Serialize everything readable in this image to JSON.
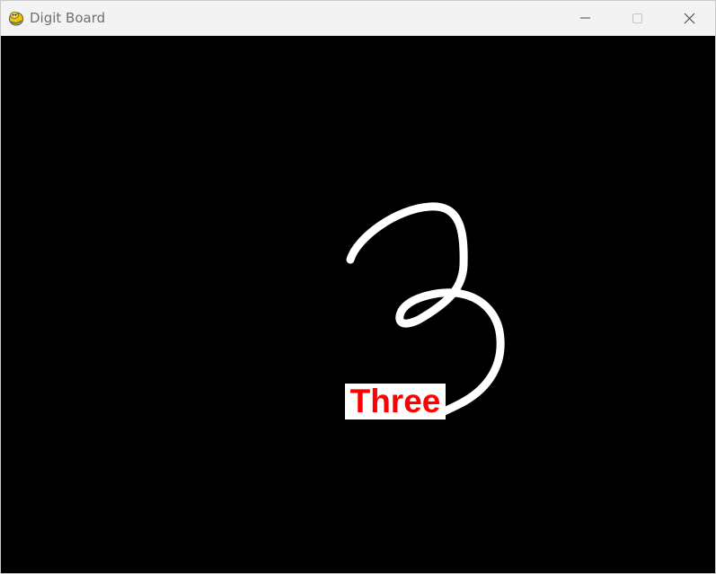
{
  "window": {
    "title": "Digit Board",
    "app_icon": "pygame-snake-icon",
    "controls": [
      "minimize-icon",
      "maximize-icon",
      "close-icon"
    ]
  },
  "canvas": {
    "background": "#000000",
    "stroke_color": "#ffffff",
    "drawn_digit": "3"
  },
  "prediction": {
    "label": "Three",
    "text_color": "#ff0000",
    "background": "#ffffff"
  }
}
